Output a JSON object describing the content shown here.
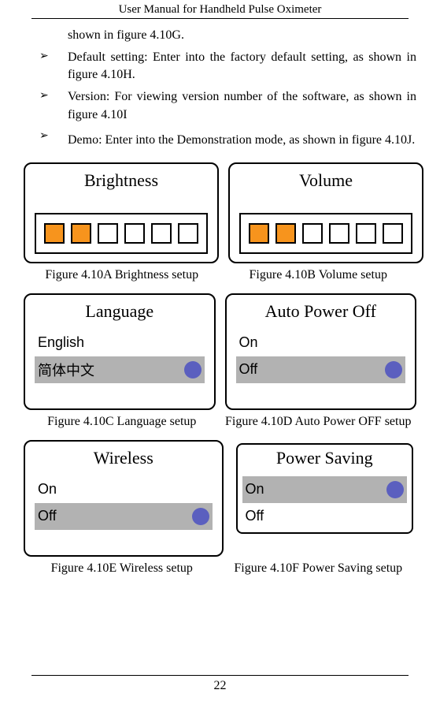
{
  "header": {
    "title": "User Manual for Handheld Pulse Oximeter"
  },
  "paragraphs": {
    "cont": "shown in figure 4.10G.",
    "b1": "Default setting: Enter into the factory default setting, as shown in figure 4.10H.",
    "b2": "Version: For viewing version number of the software, as shown in figure 4.10I",
    "b3": "Demo: Enter into the Demonstration mode, as shown in figure 4.10J."
  },
  "figures": {
    "a": {
      "title": "Brightness",
      "caption": "Figure 4.10A    Brightness setup"
    },
    "b": {
      "title": "Volume",
      "caption": "Figure 4.10B    Volume setup"
    },
    "c": {
      "title": "Language",
      "opt1": "English",
      "opt2": "简体中文",
      "caption": "Figure 4.10C    Language setup"
    },
    "d": {
      "title": "Auto Power Off",
      "opt1": "On",
      "opt2": "Off",
      "caption": "Figure 4.10D    Auto Power OFF setup"
    },
    "e": {
      "title": "Wireless",
      "opt1": "On",
      "opt2": "Off",
      "caption": "Figure 4.10E    Wireless setup"
    },
    "f": {
      "title": "Power Saving",
      "opt1": "On",
      "opt2": "Off",
      "caption": "Figure 4.10F    Power Saving setup"
    }
  },
  "page": {
    "number": "22"
  }
}
